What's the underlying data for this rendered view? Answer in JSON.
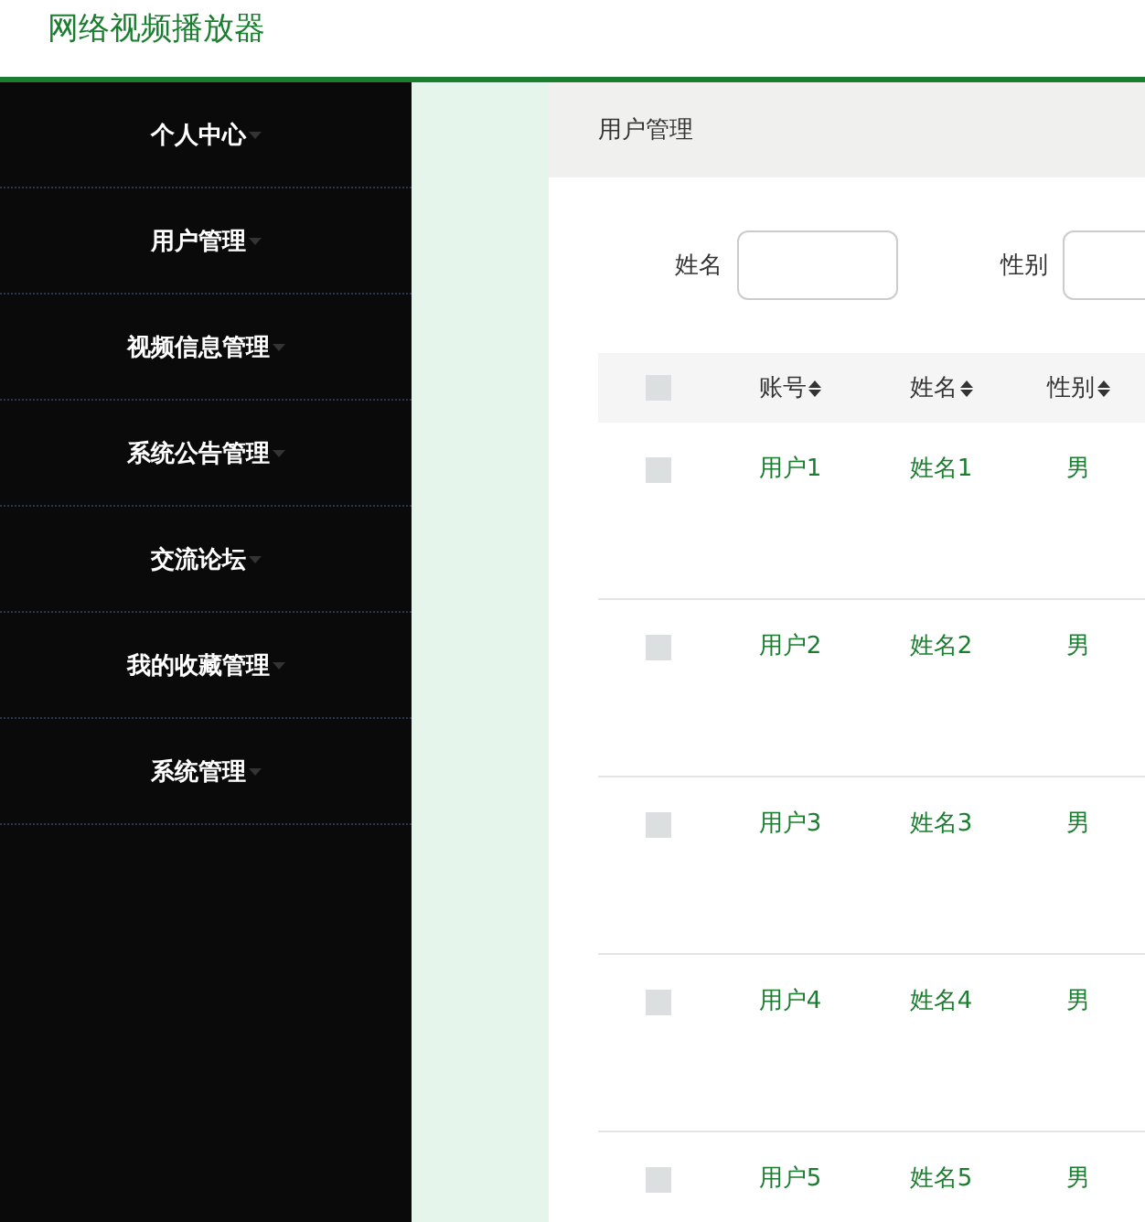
{
  "header": {
    "title": "网络视频播放器"
  },
  "sidebar": {
    "items": [
      {
        "label": "个人中心"
      },
      {
        "label": "用户管理"
      },
      {
        "label": "视频信息管理"
      },
      {
        "label": "系统公告管理"
      },
      {
        "label": "交流论坛"
      },
      {
        "label": "我的收藏管理"
      },
      {
        "label": "系统管理"
      }
    ]
  },
  "breadcrumb": "用户管理",
  "search": {
    "fields": [
      {
        "label": "姓名"
      },
      {
        "label": "性别"
      }
    ]
  },
  "table": {
    "header_checked": false,
    "columns": [
      "账号",
      "姓名",
      "性别"
    ],
    "rows": [
      {
        "checked": false,
        "cells": [
          "用户1",
          "姓名1",
          "男"
        ]
      },
      {
        "checked": false,
        "cells": [
          "用户2",
          "姓名2",
          "男"
        ]
      },
      {
        "checked": false,
        "cells": [
          "用户3",
          "姓名3",
          "男"
        ]
      },
      {
        "checked": false,
        "cells": [
          "用户4",
          "姓名4",
          "男"
        ]
      },
      {
        "checked": false,
        "cells": [
          "用户5",
          "姓名5",
          "男"
        ]
      }
    ]
  }
}
